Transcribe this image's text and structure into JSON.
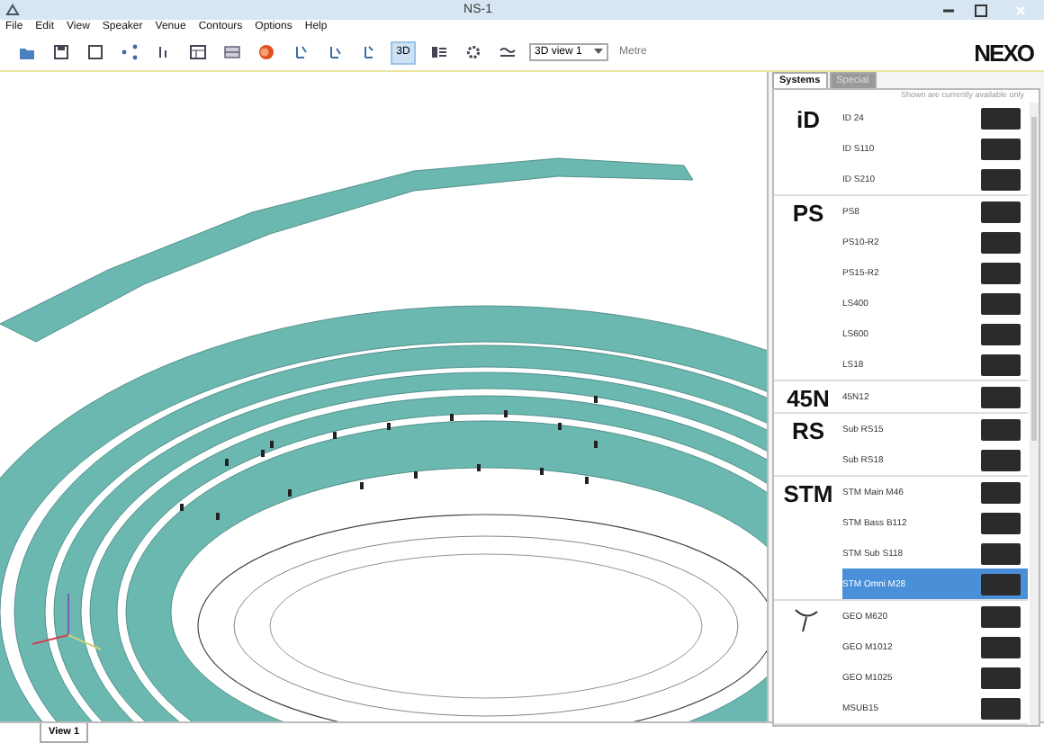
{
  "window": {
    "title": "NS-1"
  },
  "menu": [
    "File",
    "Edit",
    "View",
    "Speaker",
    "Venue",
    "Contours",
    "Options",
    "Help"
  ],
  "toolbar": {
    "view_3d": {
      "label": "3D",
      "selected": true
    },
    "view_select": {
      "value": "3D view 1"
    },
    "units": "Metre",
    "logo": "NEXO"
  },
  "panel": {
    "tabs": [
      {
        "label": "Systems",
        "selected": true
      },
      {
        "label": "Special",
        "selected": false
      }
    ],
    "note": "Shown are currently available only",
    "groups": [
      {
        "logo": "iD",
        "items": [
          {
            "name": "ID 24",
            "selected": false
          },
          {
            "name": "ID S110",
            "selected": false
          },
          {
            "name": "ID S210",
            "selected": false
          }
        ]
      },
      {
        "logo": "PS",
        "items": [
          {
            "name": "PS8",
            "selected": false
          },
          {
            "name": "PS10-R2",
            "selected": false
          },
          {
            "name": "PS15-R2",
            "selected": false
          },
          {
            "name": "LS400",
            "selected": false
          },
          {
            "name": "LS600",
            "selected": false
          },
          {
            "name": "LS18",
            "selected": false
          }
        ]
      },
      {
        "logo": "45N",
        "items": [
          {
            "name": "45N12",
            "selected": false
          }
        ]
      },
      {
        "logo": "RS",
        "items": [
          {
            "name": "Sub RS15",
            "selected": false
          },
          {
            "name": "Sub RS18",
            "selected": false
          }
        ]
      },
      {
        "logo": "STM",
        "items": [
          {
            "name": "STM Main M46",
            "selected": false
          },
          {
            "name": "STM Bass B112",
            "selected": false
          },
          {
            "name": "STM Sub S118",
            "selected": false
          },
          {
            "name": "STM Omni M28",
            "selected": true
          }
        ]
      },
      {
        "items": [
          {
            "name": "GEO M620",
            "selected": false
          },
          {
            "name": "GEO M1012",
            "selected": false
          },
          {
            "name": "GEO M1025",
            "selected": false
          },
          {
            "name": "MSUB15",
            "selected": false
          }
        ]
      }
    ]
  },
  "view_tabs": [
    {
      "label": "View 1",
      "selected": true
    }
  ]
}
